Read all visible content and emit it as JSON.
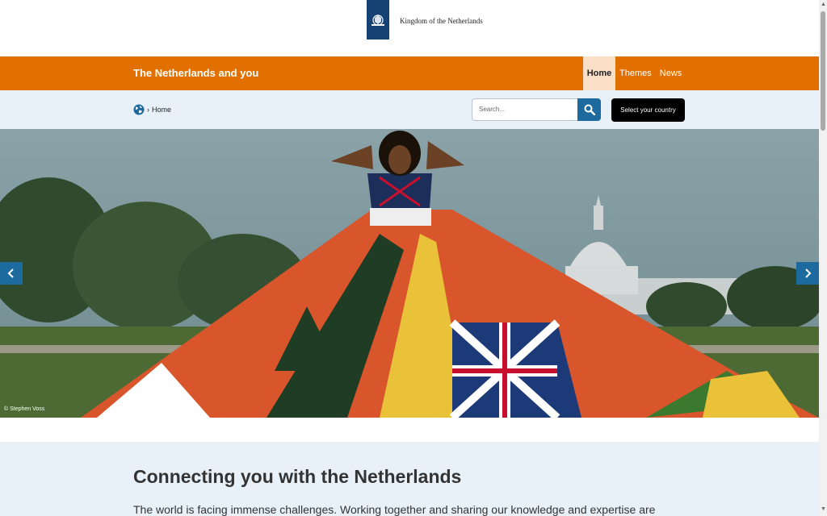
{
  "header": {
    "logo_text": "Kingdom of the Netherlands"
  },
  "nav": {
    "site_title": "The Netherlands and you",
    "tabs": [
      {
        "label": "Home",
        "active": true
      },
      {
        "label": "Themes",
        "active": false
      },
      {
        "label": "News",
        "active": false
      }
    ]
  },
  "breadcrumb": {
    "items": [
      "Home"
    ]
  },
  "search": {
    "placeholder": "Search..."
  },
  "country_button": {
    "label": "Select your country"
  },
  "hero": {
    "credit": "© Stephen Voss"
  },
  "main": {
    "heading": "Connecting you with the Netherlands",
    "intro": "The world is facing immense challenges. Working together and sharing our knowledge and expertise are"
  },
  "colors": {
    "brand_orange": "#e17000",
    "brand_blue": "#154273",
    "accent_blue": "#1d6b9e",
    "light_blue_bg": "#e8f1f8"
  },
  "icons": {
    "logo": "royal-coat-of-arms-icon",
    "breadcrumb": "globe-icon",
    "search": "search-icon",
    "carousel_prev": "chevron-left-icon",
    "carousel_next": "chevron-right-icon"
  }
}
